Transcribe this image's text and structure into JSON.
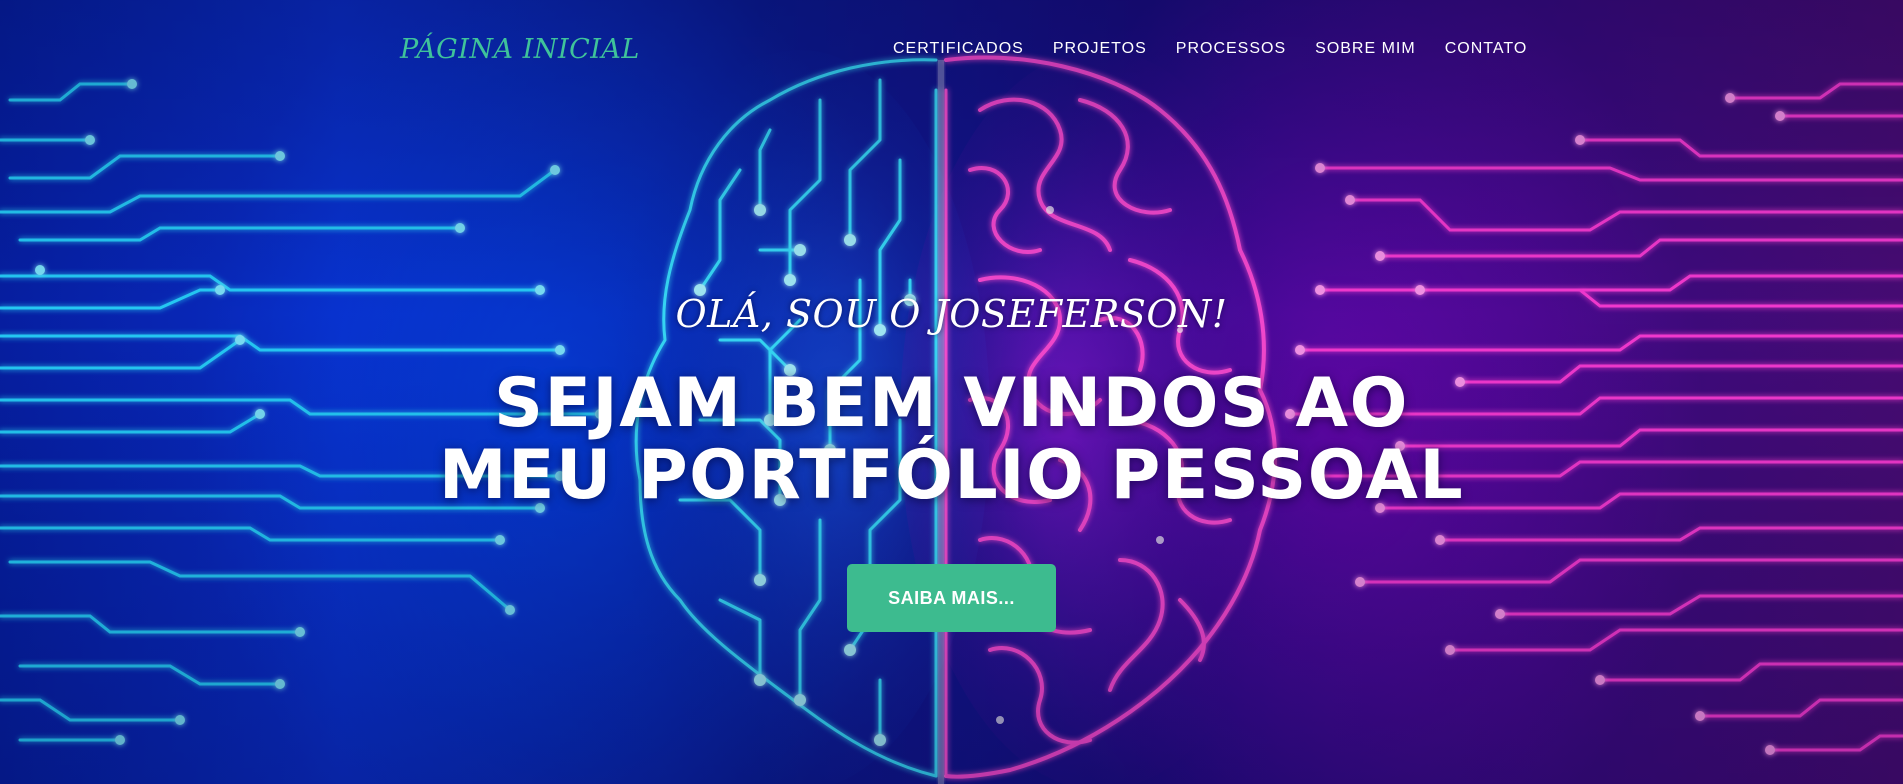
{
  "navbar": {
    "brand": "PÁGINA INICIAL",
    "links": [
      {
        "label": "CERTIFICADOS"
      },
      {
        "label": "PROJETOS"
      },
      {
        "label": "PROCESSOS"
      },
      {
        "label": "SOBRE MIM"
      },
      {
        "label": "CONTATO"
      }
    ]
  },
  "hero": {
    "subtitle": "OLÁ, SOU O JOSEFERSON!",
    "headline_line1": "SEJAM BEM VINDOS AO",
    "headline_line2": "MEU PORTFÓLIO PESSOAL",
    "cta_label": "SAIBA MAIS..."
  },
  "colors": {
    "accent": "#3dbb8f",
    "brand_text": "#3fc39a",
    "circuit_left": "#27d3ff",
    "circuit_right": "#ff3ad8"
  },
  "icons": {
    "background": "circuit-brain-illustration"
  }
}
